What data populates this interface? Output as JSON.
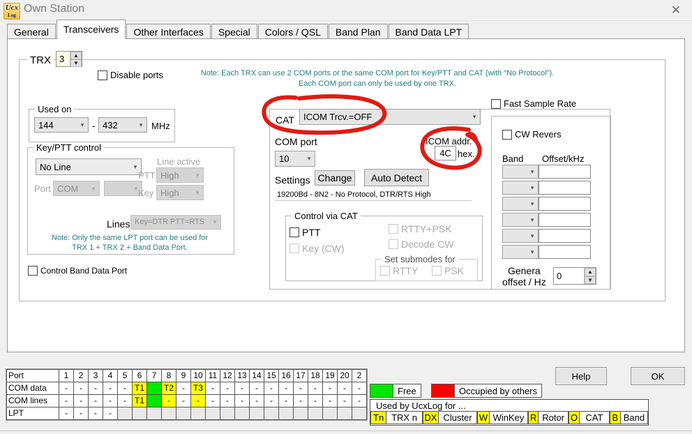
{
  "window": {
    "title": "Own Station",
    "close_label": "✕",
    "icon_name": "ucxlog-app-icon",
    "icon_text": "Ucx",
    "icon_sub": "Log"
  },
  "tabs": [
    {
      "label": "General",
      "active": false
    },
    {
      "label": "Transceivers",
      "active": true
    },
    {
      "label": "Other Interfaces",
      "active": false
    },
    {
      "label": "Special",
      "active": false
    },
    {
      "label": "Colors / QSL",
      "active": false
    },
    {
      "label": "Band Plan",
      "active": false
    },
    {
      "label": "Band Data LPT",
      "active": false
    }
  ],
  "trx": {
    "label": "TRX",
    "value": "3",
    "disable_ports_label": "Disable ports",
    "disable_ports_checked": false
  },
  "notes": {
    "line1": "Note: Each TRX can use 2 COM ports or the same COM port for Key/PTT and CAT (with \"No Protocol\").",
    "line2": "Each COM port can only be used by one TRX.",
    "lpt_line1": "Note: Only the same LPT port can be used for",
    "lpt_line2": "TRX 1 + TRX 2 + Band Data Port."
  },
  "used_on": {
    "legend": "Used on",
    "from": "144",
    "dash": "-",
    "to": "432",
    "unit": "MHz"
  },
  "keyptt": {
    "legend": "Key/PTT control",
    "line_select": "No Line",
    "port_label": "Port",
    "port_value": "COM",
    "port_num": "",
    "line_active_label": "Line active",
    "ptt_label": "PTT",
    "ptt_value": "High",
    "key_label": "Key",
    "key_value": "High",
    "lines_label": "Lines",
    "lines_value": "Key=DTR PTT=RTS"
  },
  "control_band_data_port": {
    "label": "Control Band Data Port",
    "checked": false
  },
  "cat": {
    "label": "CAT",
    "value": "ICOM Trcv.=OFF",
    "com_port_label": "COM port",
    "com_port_value": "10",
    "settings_label": "Settings",
    "change_button": "Change",
    "auto_detect_button": "Auto Detect",
    "settings_summary": "19200Bd - 8N2 - No Protocol, DTR/RTS High",
    "icom_addr_label": "ICOM addr.",
    "icom_addr_value": "4C",
    "icom_addr_unit": "hex."
  },
  "control_via_cat": {
    "legend": "Control via CAT",
    "ptt": {
      "label": "PTT",
      "checked": false,
      "enabled": true
    },
    "key_cw": {
      "label": "Key (CW)",
      "checked": false,
      "enabled": false
    },
    "rtty_psk": {
      "label": "RTTY+PSK",
      "checked": false,
      "enabled": false
    },
    "decode_cw": {
      "label": "Decode CW",
      "checked": false,
      "enabled": false
    },
    "submodes_legend": "Set submodes for",
    "submode_rtty": {
      "label": "RTTY",
      "checked": false,
      "enabled": false
    },
    "submode_psk": {
      "label": "PSK",
      "checked": false,
      "enabled": false
    }
  },
  "right_panel": {
    "fast_sample_rate": {
      "label": "Fast Sample Rate",
      "checked": false
    },
    "cw_revers": {
      "label": "CW Revers",
      "checked": false
    },
    "band_header": "Band",
    "offset_header": "Offset/kHz",
    "rows": [
      {
        "band": "",
        "offset": ""
      },
      {
        "band": "",
        "offset": ""
      },
      {
        "band": "",
        "offset": ""
      },
      {
        "band": "",
        "offset": ""
      },
      {
        "band": "",
        "offset": ""
      },
      {
        "band": "",
        "offset": ""
      }
    ],
    "general_offset_label_1": "Genera",
    "general_offset_label_2": "offset / Hz",
    "general_offset_value": "0"
  },
  "buttons": {
    "help": "Help",
    "ok": "OK"
  },
  "port_table": {
    "columns": [
      "Port",
      "1",
      "2",
      "3",
      "4",
      "5",
      "6",
      "7",
      "8",
      "9",
      "10",
      "11",
      "12",
      "13",
      "14",
      "15",
      "16",
      "17",
      "18",
      "19",
      "20",
      "2"
    ],
    "rows": [
      {
        "header": "COM data",
        "cells": [
          {
            "text": "-",
            "bg": "none"
          },
          {
            "text": "-",
            "bg": "none"
          },
          {
            "text": "-",
            "bg": "none"
          },
          {
            "text": "-",
            "bg": "none"
          },
          {
            "text": "-",
            "bg": "none"
          },
          {
            "text": "T1",
            "bg": "yellow"
          },
          {
            "text": "",
            "bg": "green"
          },
          {
            "text": "T2",
            "bg": "yellow"
          },
          {
            "text": "-",
            "bg": "none"
          },
          {
            "text": "T3",
            "bg": "yellow"
          },
          {
            "text": "-",
            "bg": "none"
          },
          {
            "text": "-",
            "bg": "none"
          },
          {
            "text": "-",
            "bg": "none"
          },
          {
            "text": "-",
            "bg": "none"
          },
          {
            "text": "-",
            "bg": "none"
          },
          {
            "text": "-",
            "bg": "none"
          },
          {
            "text": "-",
            "bg": "none"
          },
          {
            "text": "-",
            "bg": "none"
          },
          {
            "text": "-",
            "bg": "none"
          },
          {
            "text": "-",
            "bg": "none"
          },
          {
            "text": "-",
            "bg": "none"
          }
        ]
      },
      {
        "header": "COM lines",
        "cells": [
          {
            "text": "-",
            "bg": "none"
          },
          {
            "text": "-",
            "bg": "none"
          },
          {
            "text": "-",
            "bg": "none"
          },
          {
            "text": "-",
            "bg": "none"
          },
          {
            "text": "-",
            "bg": "none"
          },
          {
            "text": "T1",
            "bg": "yellow"
          },
          {
            "text": "",
            "bg": "green"
          },
          {
            "text": "-",
            "bg": "yellow"
          },
          {
            "text": "-",
            "bg": "none"
          },
          {
            "text": "-",
            "bg": "yellow"
          },
          {
            "text": "-",
            "bg": "none"
          },
          {
            "text": "-",
            "bg": "none"
          },
          {
            "text": "-",
            "bg": "none"
          },
          {
            "text": "-",
            "bg": "none"
          },
          {
            "text": "-",
            "bg": "none"
          },
          {
            "text": "-",
            "bg": "none"
          },
          {
            "text": "-",
            "bg": "none"
          },
          {
            "text": "-",
            "bg": "none"
          },
          {
            "text": "-",
            "bg": "none"
          },
          {
            "text": "-",
            "bg": "none"
          },
          {
            "text": "-",
            "bg": "none"
          }
        ]
      },
      {
        "header": "LPT",
        "cells": [
          {
            "text": "-",
            "bg": "none"
          },
          {
            "text": "-",
            "bg": "none"
          },
          {
            "text": "-",
            "bg": "none"
          },
          {
            "text": "-",
            "bg": "none"
          },
          {
            "text": "",
            "bg": "grey"
          },
          {
            "text": "",
            "bg": "grey"
          },
          {
            "text": "",
            "bg": "grey"
          },
          {
            "text": "",
            "bg": "grey"
          },
          {
            "text": "",
            "bg": "grey"
          },
          {
            "text": "",
            "bg": "grey"
          },
          {
            "text": "",
            "bg": "grey"
          },
          {
            "text": "",
            "bg": "grey"
          },
          {
            "text": "",
            "bg": "grey"
          },
          {
            "text": "",
            "bg": "grey"
          },
          {
            "text": "",
            "bg": "grey"
          },
          {
            "text": "",
            "bg": "grey"
          },
          {
            "text": "",
            "bg": "grey"
          },
          {
            "text": "",
            "bg": "grey"
          },
          {
            "text": "",
            "bg": "grey"
          },
          {
            "text": "",
            "bg": "grey"
          },
          {
            "text": "",
            "bg": "grey"
          }
        ]
      }
    ]
  },
  "legend": {
    "free_label": "Free",
    "free_color": "#00e800",
    "occupied_label": "Occupied by others",
    "occupied_color": "#ff0000",
    "used_title": "Used by UcxLog for ...",
    "used_items": [
      {
        "key": "Tn",
        "value": "TRX n"
      },
      {
        "key": "DX",
        "value": "Cluster"
      },
      {
        "key": "W",
        "value": "WinKey"
      },
      {
        "key": "R",
        "value": "Rotor"
      },
      {
        "key": "O",
        "value": "CAT"
      },
      {
        "key": "B",
        "value": "Band"
      }
    ]
  },
  "annotations": {
    "cat_circle": "red-ellipse-around-cat-dropdown",
    "icom_circle": "red-ellipse-around-icom-address"
  }
}
